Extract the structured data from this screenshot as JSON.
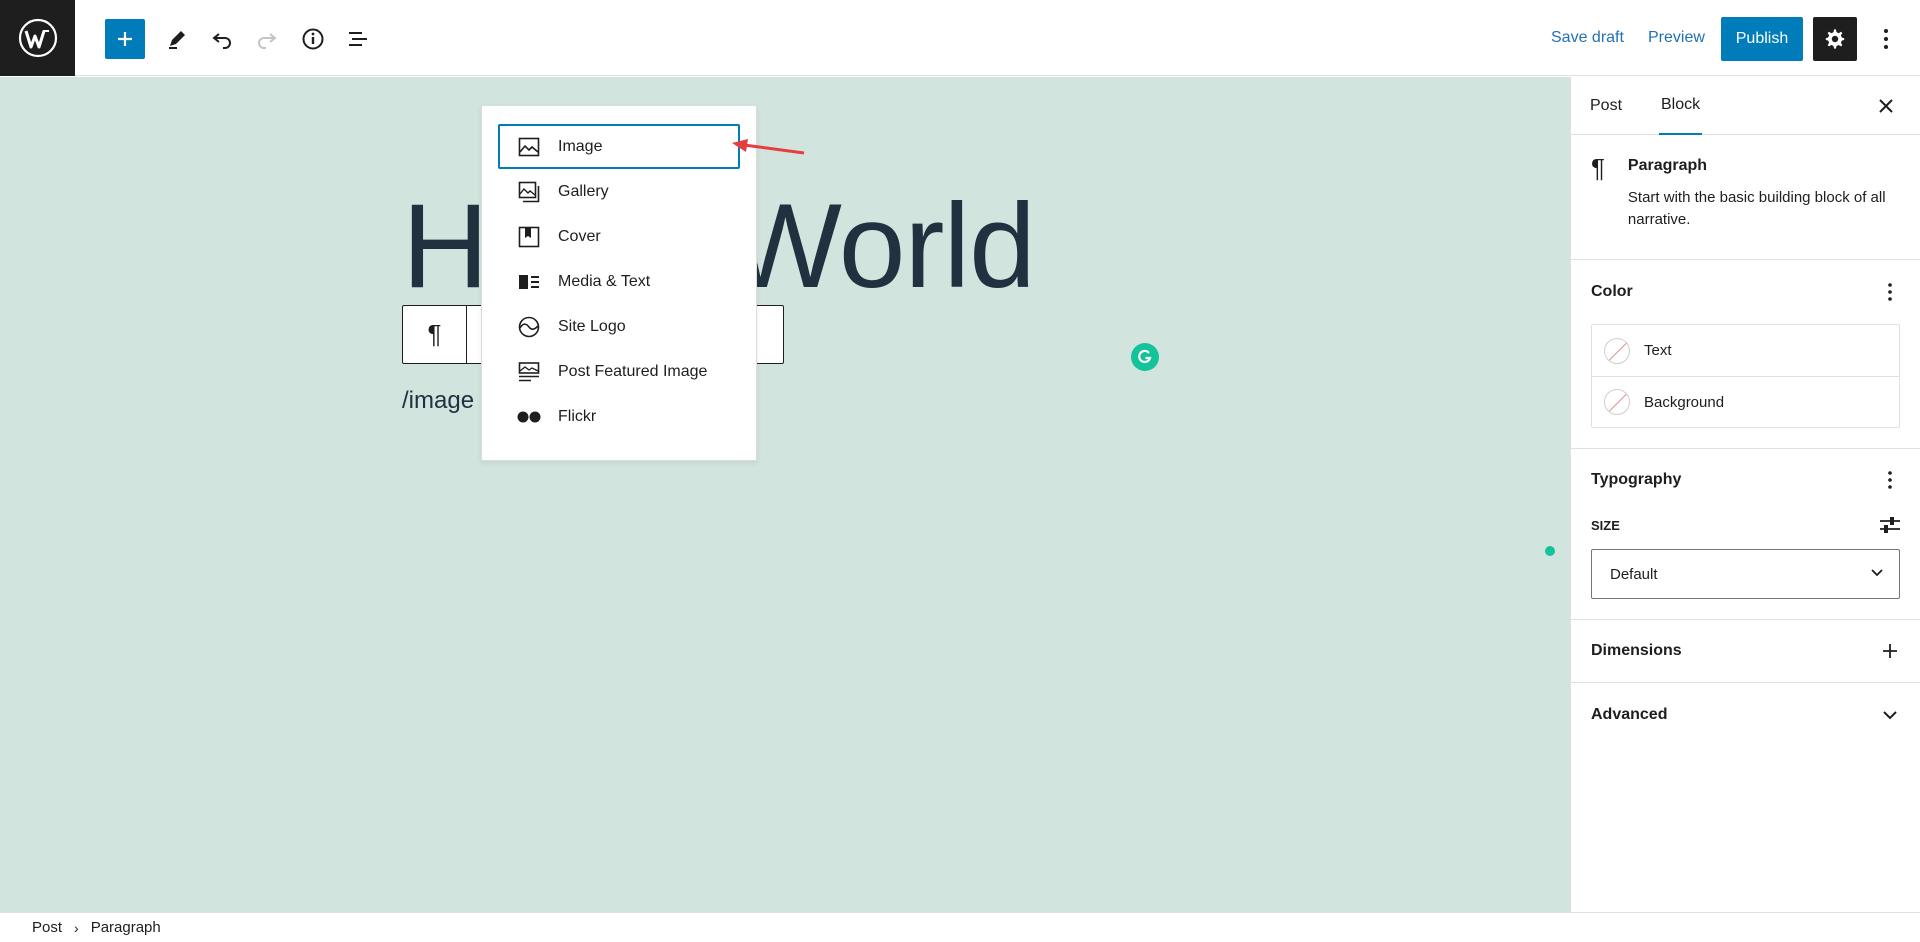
{
  "toolbar": {
    "save_draft": "Save draft",
    "preview": "Preview",
    "publish": "Publish"
  },
  "editor": {
    "title_visible_left": "H",
    "title_visible_right": "World",
    "paragraph_text": "/image"
  },
  "autocomplete": {
    "items": [
      {
        "label": "Image",
        "icon": "image-icon",
        "active": true
      },
      {
        "label": "Gallery",
        "icon": "gallery-icon"
      },
      {
        "label": "Cover",
        "icon": "cover-icon"
      },
      {
        "label": "Media & Text",
        "icon": "media-text-icon"
      },
      {
        "label": "Site Logo",
        "icon": "site-logo-icon"
      },
      {
        "label": "Post Featured Image",
        "icon": "featured-image-icon"
      },
      {
        "label": "Flickr",
        "icon": "flickr-icon"
      }
    ]
  },
  "sidebar": {
    "tabs": [
      {
        "label": "Post",
        "active": false
      },
      {
        "label": "Block",
        "active": true
      }
    ],
    "block": {
      "title": "Paragraph",
      "description": "Start with the basic building block of all narrative."
    },
    "color": {
      "heading": "Color",
      "options": [
        "Text",
        "Background"
      ]
    },
    "typography": {
      "heading": "Typography",
      "size_label": "SIZE",
      "size_value": "Default"
    },
    "dimensions": {
      "heading": "Dimensions"
    },
    "advanced": {
      "heading": "Advanced"
    }
  },
  "breadcrumb": [
    "Post",
    "Paragraph"
  ],
  "colors": {
    "accent": "#007cba",
    "canvas_bg": "#d2e4de",
    "dark": "#1e1e1e",
    "grammarly": "#15c39a",
    "annotation_arrow": "#e53e3e"
  }
}
